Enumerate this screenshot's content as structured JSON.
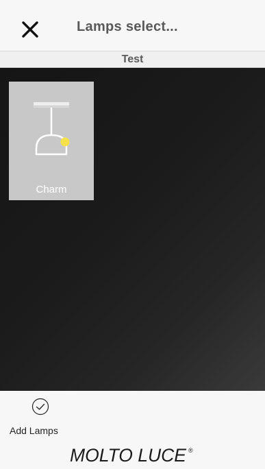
{
  "header": {
    "title": "Lamps select...",
    "close_icon": "close-icon"
  },
  "subheader": {
    "label": "Test"
  },
  "lamps": [
    {
      "name": "Charm",
      "icon": "pendant-lamp-icon",
      "accent_color": "#f5e24a"
    }
  ],
  "footer": {
    "add_lamps_label": "Add Lamps",
    "add_icon": "check-circle-icon",
    "brand": "MOLTO LUCE",
    "brand_mark": "®"
  },
  "colors": {
    "header_bg": "#f7f7f7",
    "canvas_dark": "#151515",
    "card_bg": "#c8c8c8"
  }
}
